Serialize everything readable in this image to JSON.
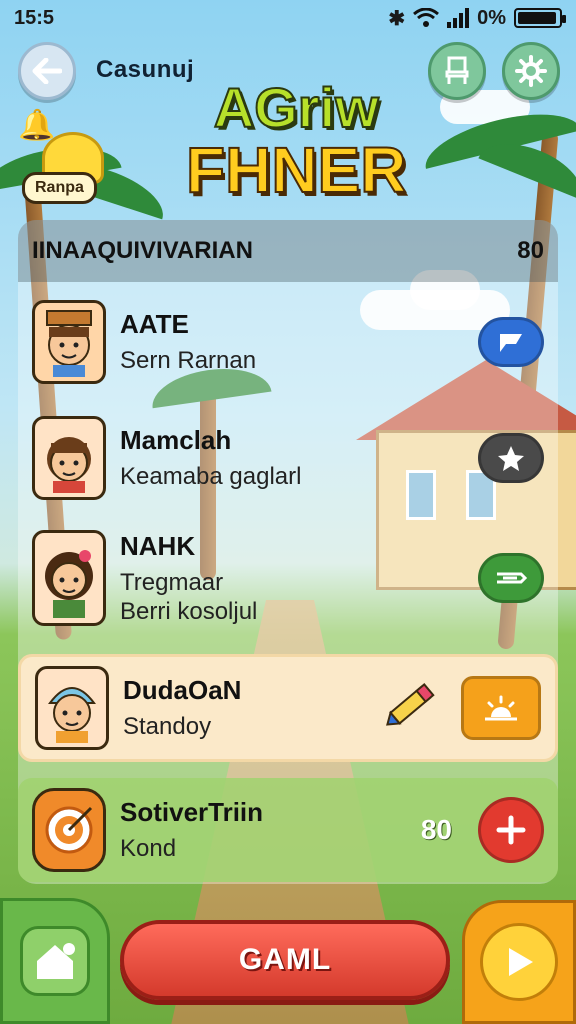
{
  "status": {
    "time": "15:5",
    "battery": "0%"
  },
  "header": {
    "title": "Casunuj",
    "logo_line1": "AGriw",
    "logo_line2": "FHNER",
    "badge": "Ranpa"
  },
  "panel": {
    "heading": "IINAAQUIVIVARIAN",
    "heading_value": "80"
  },
  "rows": [
    {
      "title": "AATE",
      "subtitle": "Sern Rarnan",
      "action_icon": "chat-bubble-icon",
      "action_color": "#2f6fd6"
    },
    {
      "title": "Mamclah",
      "subtitle": "Keamaba gaglarl",
      "action_icon": "puzzle-icon",
      "action_color": "#4a4a4a"
    },
    {
      "title": "NAHK",
      "subtitle_1": "Tregmaar",
      "subtitle_2": "Berri kosoljul",
      "action_icon": "tag-icon",
      "action_color": "#3e9a3a"
    },
    {
      "title": "DudaOaN",
      "subtitle": "Standoy",
      "action_icon": "sunrise-icon",
      "action_color": "#f5a11b"
    },
    {
      "title": "SotiverTriin",
      "subtitle": "Kond",
      "value": "80",
      "action_icon": "plus-icon",
      "action_color": "#e23a2f"
    }
  ],
  "bottom": {
    "game_label": "GAML"
  }
}
